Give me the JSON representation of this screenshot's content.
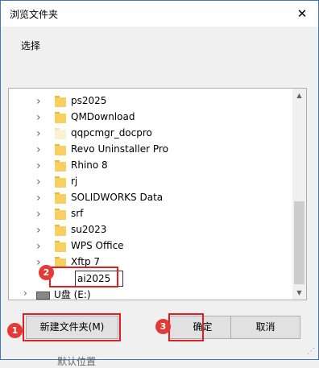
{
  "window": {
    "title": "浏览文件夹",
    "close_glyph": "✕"
  },
  "instruction": "选择",
  "tree": {
    "items": [
      {
        "label": "ps2025",
        "icon": "folder-icon"
      },
      {
        "label": "QMDownload",
        "icon": "folder-icon"
      },
      {
        "label": "qqpcmgr_docpro",
        "icon": "folder-pale-icon"
      },
      {
        "label": "Revo Uninstaller Pro",
        "icon": "folder-icon"
      },
      {
        "label": "Rhino 8",
        "icon": "folder-icon"
      },
      {
        "label": "rj",
        "icon": "folder-icon"
      },
      {
        "label": "SOLIDWORKS Data",
        "icon": "folder-icon"
      },
      {
        "label": "srf",
        "icon": "folder-icon"
      },
      {
        "label": "su2023",
        "icon": "folder-icon"
      },
      {
        "label": "WPS Office",
        "icon": "folder-icon"
      },
      {
        "label": "Xftp 7",
        "icon": "folder-icon"
      }
    ],
    "renaming_value": "ai2025",
    "drive_label": "U盘 (E:)",
    "expand_glyph": "›",
    "drive_chevron": "›"
  },
  "scrollbar": {
    "up_glyph": "▲",
    "down_glyph": "▼"
  },
  "buttons": {
    "new_folder": "新建文件夹(M)",
    "ok": "确定",
    "cancel": "取消"
  },
  "annotations": {
    "badge1": "1",
    "badge2": "2",
    "badge3": "3",
    "highlight_color": "#e02020"
  },
  "footer_hint": "默认位置",
  "colors": {
    "accent": "#3c78c8",
    "selection": "#cce8ff",
    "folder": "#f8d061"
  }
}
